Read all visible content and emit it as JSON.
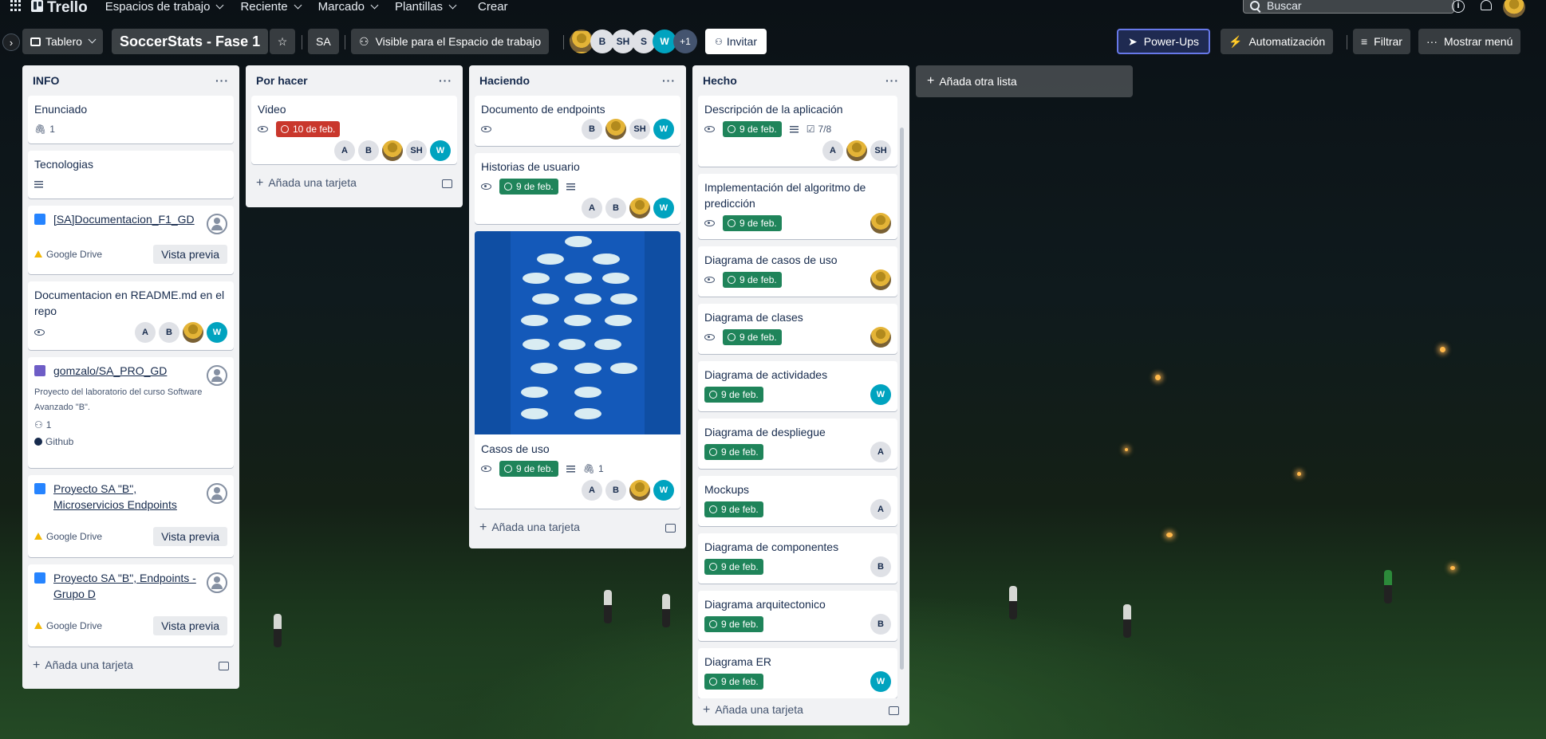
{
  "topbar": {
    "app_name": "Trello",
    "menus": [
      "Espacios de trabajo",
      "Reciente",
      "Marcado",
      "Plantillas"
    ],
    "create": "Crear",
    "search_placeholder": "Buscar"
  },
  "board": {
    "view": "Tablero",
    "title": "SoccerStats - Fase 1",
    "workspace": "SA",
    "visibility": "Visible para el Espacio de trabajo",
    "members": [
      "B",
      "SH",
      "S",
      "W"
    ],
    "extra_members": "+1",
    "invite": "Invitar",
    "powerups": "Power-Ups",
    "automation": "Automatización",
    "filter": "Filtrar",
    "menu": "Mostrar menú"
  },
  "lists": [
    {
      "title": "INFO",
      "add": "Añada una tarjeta"
    },
    {
      "title": "Por hacer",
      "add": "Añada una tarjeta"
    },
    {
      "title": "Haciendo",
      "add": "Añada una tarjeta"
    },
    {
      "title": "Hecho",
      "add": "Añada una tarjeta"
    }
  ],
  "info_cards": {
    "enunciado": {
      "title": "Enunciado",
      "attachments": "1"
    },
    "tecnologias": {
      "title": "Tecnologias"
    },
    "doc_f1": {
      "title": "[SA]Documentacion_F1_GD",
      "source": "Google Drive",
      "action": "Vista previa"
    },
    "readme": {
      "title": "Documentacion en README.md en el repo",
      "members": [
        "A",
        "B",
        "img",
        "W"
      ]
    },
    "github": {
      "title": "gomzalo/SA_PRO_GD",
      "description": "Proyecto del laboratorio del curso Software Avanzado \"B\".",
      "contributors": "1",
      "source": "Github"
    },
    "micro": {
      "title": "Proyecto SA \"B\", Microservicios Endpoints",
      "source": "Google Drive",
      "action": "Vista previa"
    },
    "endpoints": {
      "title": "Proyecto SA \"B\", Endpoints - Grupo D",
      "source": "Google Drive",
      "action": "Vista previa"
    }
  },
  "todo_cards": [
    {
      "title": "Video",
      "date": "10 de feb.",
      "members": [
        "A",
        "B",
        "img",
        "SH",
        "W"
      ]
    }
  ],
  "doing_cards": {
    "doc_endpoints": {
      "title": "Documento de endpoints",
      "members": [
        "B",
        "img",
        "SH",
        "W"
      ]
    },
    "historias": {
      "title": "Historias de usuario",
      "date": "9 de feb.",
      "members": [
        "A",
        "B",
        "img",
        "W"
      ]
    },
    "casos": {
      "title": "Casos de uso",
      "date": "9 de feb.",
      "attachments": "1",
      "members": [
        "A",
        "B",
        "img",
        "W"
      ]
    }
  },
  "done_cards": [
    {
      "title": "Descripción de la aplicación",
      "date": "9 de feb.",
      "checklist": "7/8",
      "members": [
        "A",
        "img",
        "SH"
      ]
    },
    {
      "title": "Implementación del algoritmo de predicción",
      "date": "9 de feb.",
      "members": [
        "img"
      ]
    },
    {
      "title": "Diagrama de casos de uso",
      "date": "9 de feb.",
      "members": [
        "img"
      ]
    },
    {
      "title": "Diagrama de clases",
      "date": "9 de feb.",
      "members": [
        "img"
      ]
    },
    {
      "title": "Diagrama de actividades",
      "date": "9 de feb.",
      "members": [
        "W"
      ]
    },
    {
      "title": "Diagrama de despliegue",
      "date": "9 de feb.",
      "members": [
        "A"
      ]
    },
    {
      "title": "Mockups",
      "date": "9 de feb.",
      "members": [
        "A"
      ]
    },
    {
      "title": "Diagrama de componentes",
      "date": "9 de feb.",
      "members": [
        "B"
      ]
    },
    {
      "title": "Diagrama arquitectonico",
      "date": "9 de feb.",
      "members": [
        "B"
      ]
    },
    {
      "title": "Diagrama ER",
      "date": "9 de feb.",
      "members": [
        "W"
      ]
    }
  ],
  "add_list": "Añada otra lista",
  "colors": {
    "date_green": "#1f845a",
    "date_red": "#c9372c",
    "member_w": "#00a3bf",
    "list_bg": "#f1f2f4"
  }
}
